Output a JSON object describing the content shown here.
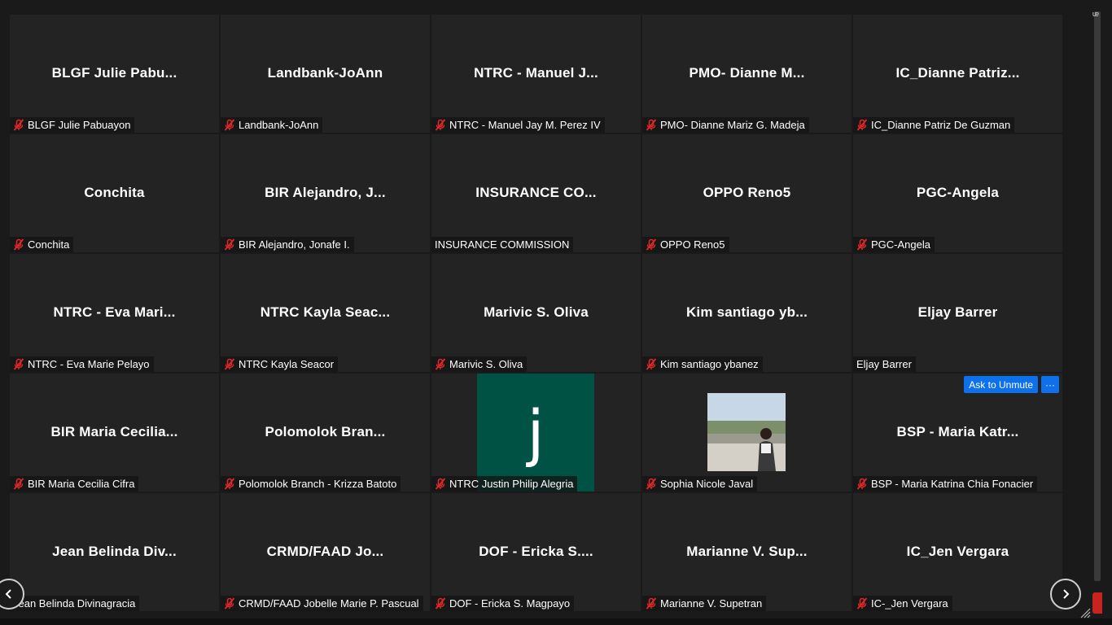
{
  "window": {
    "corner_indicator": "ᵫ"
  },
  "tiles": [
    {
      "display_name": "BLGF Julie Pabu...",
      "label": "BLGF Julie Pabuayon",
      "muted": true
    },
    {
      "display_name": "Landbank-JoAnn",
      "label": "Landbank-JoAnn",
      "muted": true
    },
    {
      "display_name": "NTRC - Manuel J...",
      "label": "NTRC - Manuel Jay M. Perez IV",
      "muted": true
    },
    {
      "display_name": "PMO- Dianne M...",
      "label": "PMO- Dianne Mariz G. Madeja",
      "muted": true
    },
    {
      "display_name": "IC_Dianne Patriz...",
      "label": "IC_Dianne Patriz De Guzman",
      "muted": true
    },
    {
      "display_name": "Conchita",
      "label": "Conchita",
      "muted": true
    },
    {
      "display_name": "BIR Alejandro, J...",
      "label": "BIR Alejandro, Jonafe I.",
      "muted": true
    },
    {
      "display_name": "INSURANCE CO...",
      "label": "INSURANCE COMMISSION",
      "muted": false
    },
    {
      "display_name": "OPPO Reno5",
      "label": "OPPO Reno5",
      "muted": true
    },
    {
      "display_name": "PGC-Angela",
      "label": "PGC-Angela",
      "muted": true
    },
    {
      "display_name": "NTRC - Eva Mari...",
      "label": "NTRC - Eva Marie Pelayo",
      "muted": true
    },
    {
      "display_name": "NTRC Kayla Seac...",
      "label": "NTRC Kayla Seacor",
      "muted": true
    },
    {
      "display_name": "Marivic S. Oliva",
      "label": "Marivic S. Oliva",
      "muted": true
    },
    {
      "display_name": "Kim santiago yb...",
      "label": "Kim santiago ybanez",
      "muted": true
    },
    {
      "display_name": "Eljay Barrer",
      "label": "Eljay Barrer",
      "muted": false
    },
    {
      "display_name": "BIR Maria Cecilia...",
      "label": "BIR Maria Cecilia Cifra",
      "muted": true
    },
    {
      "display_name": "Polomolok Bran...",
      "label": "Polomolok Branch - Krizza Batoto",
      "muted": true
    },
    {
      "display_name": "",
      "label": "NTRC Justin Philip Alegria",
      "muted": true,
      "avatar_letter": "j",
      "avatar_color": "#005245"
    },
    {
      "display_name": "",
      "label": "Sophia Nicole Javal",
      "muted": true,
      "photo": "profile-photo"
    },
    {
      "display_name": "BSP - Maria Katr...",
      "label": "BSP - Maria Katrina Chia Fonacier",
      "muted": true,
      "ask_unmute": "Ask to Unmute",
      "more": "···"
    },
    {
      "display_name": "Jean Belinda Div...",
      "label": "Jean Belinda Divinagracia",
      "muted": false
    },
    {
      "display_name": "CRMD/FAAD Jo...",
      "label": "CRMD/FAAD Jobelle Marie P. Pascual",
      "muted": true
    },
    {
      "display_name": "DOF - Ericka S....",
      "label": "DOF - Ericka S. Magpayo",
      "muted": true
    },
    {
      "display_name": "Marianne V. Sup...",
      "label": "Marianne V. Supetran",
      "muted": true
    },
    {
      "display_name": "IC_Jen Vergara",
      "label": "IC-_Jen Vergara",
      "muted": true
    }
  ],
  "colors": {
    "background": "#1a1a1a",
    "tile": "#232323",
    "mute_icon": "#e02828",
    "ask_unmute": "#0e71eb",
    "recording": "#c9231f"
  },
  "icons": {
    "muted_mic": "mic-muted-icon",
    "prev_page": "chevron-left-icon",
    "next_page": "chevron-right-icon",
    "more": "more-options-icon"
  }
}
